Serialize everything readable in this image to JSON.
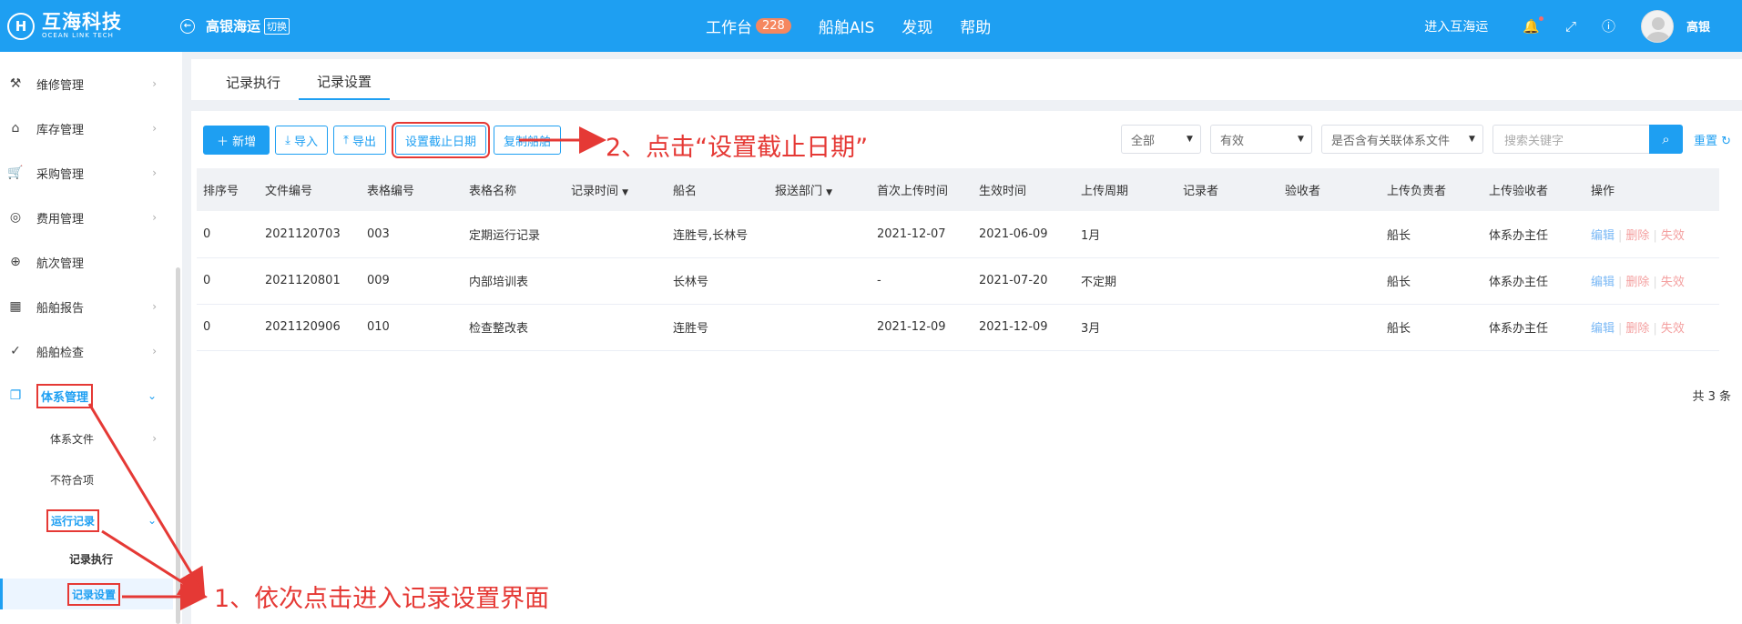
{
  "topbar": {
    "brand_cn": "互海科技",
    "brand_en": "OCEAN LINK TECH",
    "company": "高银海运",
    "switch_label": "切换",
    "nav": [
      {
        "label": "工作台",
        "badge": "228"
      },
      {
        "label": "船舶AIS"
      },
      {
        "label": "发现"
      },
      {
        "label": "帮助"
      }
    ],
    "enter_label": "进入互海运",
    "username": "高银"
  },
  "sidebar": {
    "items": [
      {
        "label": "维修管理"
      },
      {
        "label": "库存管理"
      },
      {
        "label": "采购管理"
      },
      {
        "label": "费用管理"
      },
      {
        "label": "航次管理"
      },
      {
        "label": "船舶报告"
      },
      {
        "label": "船舶检查"
      },
      {
        "label": "体系管理"
      }
    ],
    "sub": {
      "system_files": "体系文件",
      "nonconformity": "不符合项",
      "run_records": "运行记录",
      "record_exec": "记录执行",
      "record_settings": "记录设置"
    }
  },
  "tabs": [
    "记录执行",
    "记录设置"
  ],
  "toolbar": {
    "add": "新增",
    "import": "导入",
    "export": "导出",
    "set_deadline": "设置截止日期",
    "copy_ship": "复制船舶"
  },
  "filters": {
    "all": "全部",
    "valid": "有效",
    "related_files": "是否含有关联体系文件",
    "search_placeholder": "搜索关键字",
    "reset": "重置"
  },
  "table": {
    "headers": [
      "排序号",
      "文件编号",
      "表格编号",
      "表格名称",
      "记录时间",
      "船名",
      "报送部门",
      "首次上传时间",
      "生效时间",
      "上传周期",
      "记录者",
      "验收者",
      "上传负责者",
      "上传验收者",
      "操作"
    ],
    "rows": [
      [
        "0",
        "2021120703",
        "003",
        "定期运行记录",
        "",
        "连胜号,长林号",
        "",
        "2021-12-07",
        "2021-06-09",
        "1月",
        "",
        "",
        "船长",
        "体系办主任"
      ],
      [
        "0",
        "2021120801",
        "009",
        "内部培训表",
        "",
        "长林号",
        "",
        "-",
        "2021-07-20",
        "不定期",
        "",
        "",
        "船长",
        "体系办主任"
      ],
      [
        "0",
        "2021120906",
        "010",
        "检查整改表",
        "",
        "连胜号",
        "",
        "2021-12-09",
        "2021-12-09",
        "3月",
        "",
        "",
        "船长",
        "体系办主任"
      ]
    ],
    "actions": {
      "edit": "编辑",
      "delete": "删除",
      "invalidate": "失效"
    },
    "total": "共 3 条"
  },
  "annotations": {
    "step1": "1、依次点击进入记录设置界面",
    "step2": "2、点击“设置截止日期”"
  }
}
